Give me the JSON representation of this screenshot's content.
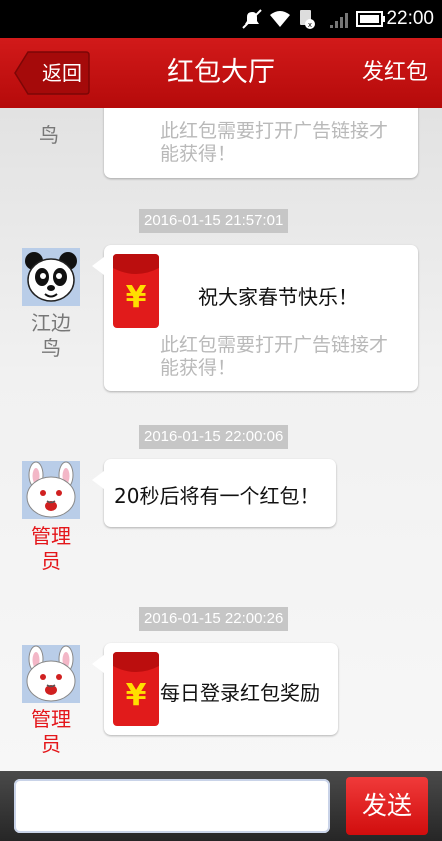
{
  "status_bar": {
    "time": "22:00"
  },
  "header": {
    "back_label": "返回",
    "title": "红包大厅",
    "action_label": "发红包"
  },
  "colors": {
    "brand_red": "#c31212",
    "admin_name": "#e4161a",
    "timestamp_chip": "#c6c6c6"
  },
  "messages": [
    {
      "sender": "鸟",
      "note": "此红包需要打开广告链接才能获得！"
    },
    {
      "timestamp": "2016-01-15 21:57:01",
      "sender_line1": "江边",
      "sender_line2": "鸟",
      "avatar": "panda-avatar",
      "icon": "red-envelope-icon",
      "text": "祝大家春节快乐！",
      "note": "此红包需要打开广告链接才能获得！"
    },
    {
      "timestamp": "2016-01-15 22:00:06",
      "sender_line1": "管理",
      "sender_line2": "员",
      "avatar": "rabbit-avatar",
      "text": "20秒后将有一个红包！"
    },
    {
      "timestamp": "2016-01-15 22:00:26",
      "sender_line1": "管理",
      "sender_line2": "员",
      "avatar": "rabbit-avatar",
      "icon": "red-envelope-icon",
      "text": "每日登录红包奖励"
    }
  ],
  "composer": {
    "input_value": "",
    "send_label": "发送"
  }
}
